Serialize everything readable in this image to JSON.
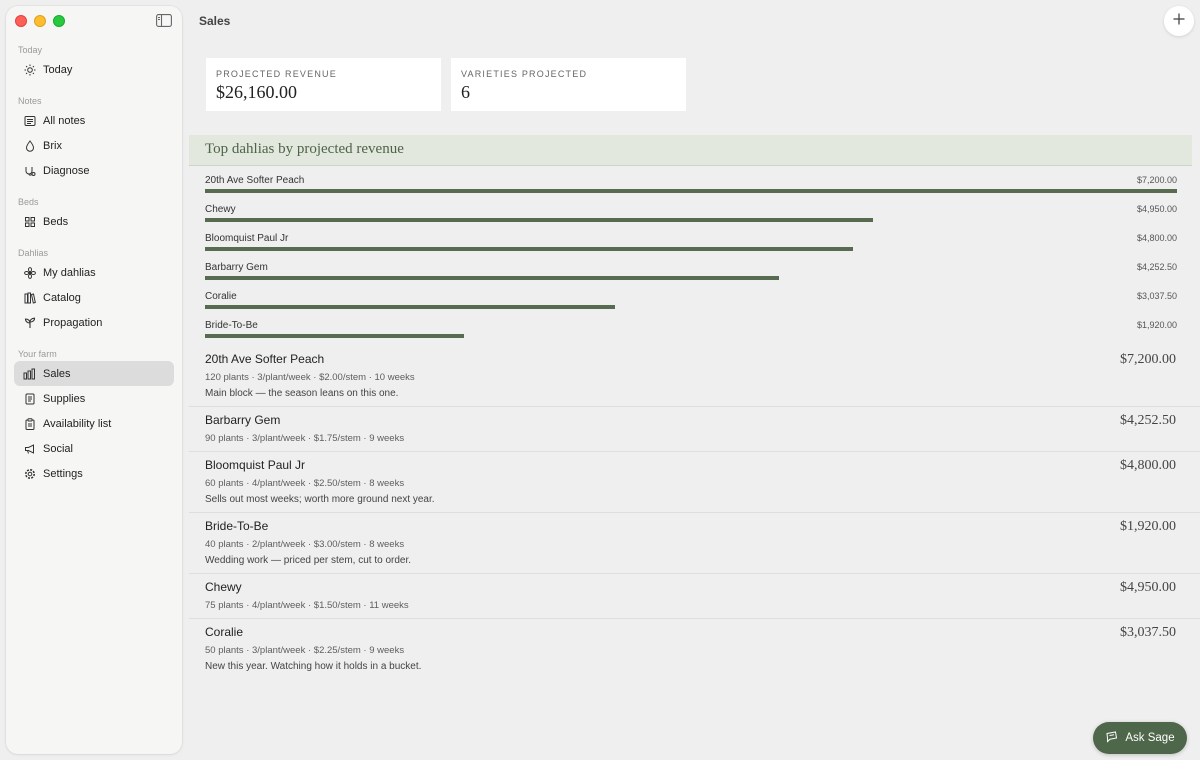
{
  "header": {
    "title": "Sales"
  },
  "sidebar": {
    "sections": [
      {
        "label": "Today",
        "items": [
          {
            "label": "Today",
            "icon": "sun-icon"
          }
        ]
      },
      {
        "label": "Notes",
        "items": [
          {
            "label": "All notes",
            "icon": "notes-icon"
          },
          {
            "label": "Brix",
            "icon": "drop-icon"
          },
          {
            "label": "Diagnose",
            "icon": "diagnose-icon"
          }
        ]
      },
      {
        "label": "Beds",
        "items": [
          {
            "label": "Beds",
            "icon": "grid-icon"
          }
        ]
      },
      {
        "label": "Dahlias",
        "items": [
          {
            "label": "My dahlias",
            "icon": "flower-icon"
          },
          {
            "label": "Catalog",
            "icon": "books-icon"
          },
          {
            "label": "Propagation",
            "icon": "sprout-icon"
          }
        ]
      },
      {
        "label": "Your farm",
        "items": [
          {
            "label": "Sales",
            "icon": "bar-chart-icon",
            "active": true
          },
          {
            "label": "Supplies",
            "icon": "document-icon"
          },
          {
            "label": "Availability list",
            "icon": "clipboard-icon"
          },
          {
            "label": "Social",
            "icon": "megaphone-icon"
          },
          {
            "label": "Settings",
            "icon": "gear-icon"
          }
        ]
      }
    ]
  },
  "stats": {
    "projected_revenue_label": "PROJECTED REVENUE",
    "projected_revenue_value": "$26,160.00",
    "varieties_label": "VARIETIES PROJECTED",
    "varieties_value": "6"
  },
  "chart_title": "Top dahlias by projected revenue",
  "chart_data": {
    "type": "bar",
    "title": "Top dahlias by projected revenue",
    "categories": [
      "20th Ave Softer Peach",
      "Chewy",
      "Bloomquist Paul Jr",
      "Barbarry Gem",
      "Coralie",
      "Bride-To-Be"
    ],
    "values": [
      7200,
      4950,
      4800,
      4252.5,
      3037.5,
      1920
    ],
    "value_labels": [
      "$7,200.00",
      "$4,950.00",
      "$4,800.00",
      "$4,252.50",
      "$3,037.50",
      "$1,920.00"
    ],
    "xlim": [
      0,
      7200
    ],
    "bar_color": "#566b4f"
  },
  "varieties": [
    {
      "name": "20th Ave Softer Peach",
      "meta": "120 plants · 3/plant/week · $2.00/stem · 10 weeks",
      "note": "Main block — the season leans on this one.",
      "price": "$7,200.00"
    },
    {
      "name": "Barbarry Gem",
      "meta": "90 plants · 3/plant/week · $1.75/stem · 9 weeks",
      "note": "",
      "price": "$4,252.50"
    },
    {
      "name": "Bloomquist Paul Jr",
      "meta": "60 plants · 4/plant/week · $2.50/stem · 8 weeks",
      "note": "Sells out most weeks; worth more ground next year.",
      "price": "$4,800.00"
    },
    {
      "name": "Bride-To-Be",
      "meta": "40 plants · 2/plant/week · $3.00/stem · 8 weeks",
      "note": "Wedding work — priced per stem, cut to order.",
      "price": "$1,920.00"
    },
    {
      "name": "Chewy",
      "meta": "75 plants · 4/plant/week · $1.50/stem · 11 weeks",
      "note": "",
      "price": "$4,950.00"
    },
    {
      "name": "Coralie",
      "meta": "50 plants · 3/plant/week · $2.25/stem · 9 weeks",
      "note": "New this year. Watching how it holds in a bucket.",
      "price": "$3,037.50"
    }
  ],
  "assistant_button": {
    "label": "Ask Sage",
    "icon": "chat-icon"
  },
  "colors": {
    "accent": "#4e6649",
    "bar": "#566b4f",
    "chart_header_bg": "#e3e8df"
  }
}
